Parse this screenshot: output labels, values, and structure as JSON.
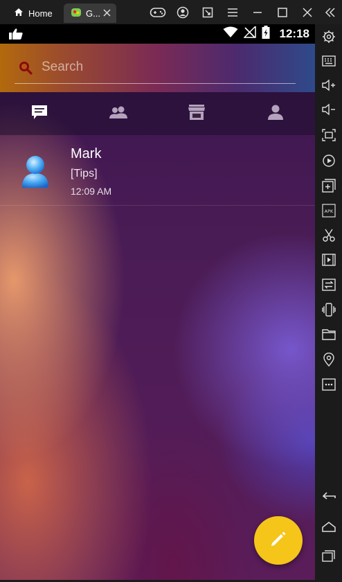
{
  "titlebar": {
    "home_tab": "Home",
    "game_tab": "G...",
    "icons": [
      "gamepad-icon",
      "account-icon",
      "resize-icon",
      "menu-icon",
      "minimize-icon",
      "maximize-icon",
      "close-icon",
      "collapse-icon"
    ]
  },
  "statusbar": {
    "time": "12:18"
  },
  "search": {
    "placeholder": "Search",
    "value": ""
  },
  "tabs": [
    {
      "icon": "chat-icon",
      "active": true
    },
    {
      "icon": "contacts-icon",
      "active": false
    },
    {
      "icon": "store-icon",
      "active": false
    },
    {
      "icon": "profile-icon",
      "active": false
    }
  ],
  "conversations": [
    {
      "name": "Mark",
      "message": "[Tips]",
      "time": "12:09 AM"
    }
  ],
  "colors": {
    "fab": "#f5c519",
    "tab_active": "#ffffff",
    "tab_inactive": "#b5a3bd"
  },
  "sidebar": {
    "icons": [
      "settings-icon",
      "keyboard-icon",
      "volume-up-icon",
      "volume-down-icon",
      "screenshot-icon",
      "record-icon",
      "add-app-icon",
      "apk-icon",
      "scissors-icon",
      "video-icon",
      "transfer-icon",
      "shake-icon",
      "folder-icon",
      "location-icon",
      "more-icon",
      "back-icon",
      "home-icon",
      "recent-apps-icon"
    ]
  }
}
